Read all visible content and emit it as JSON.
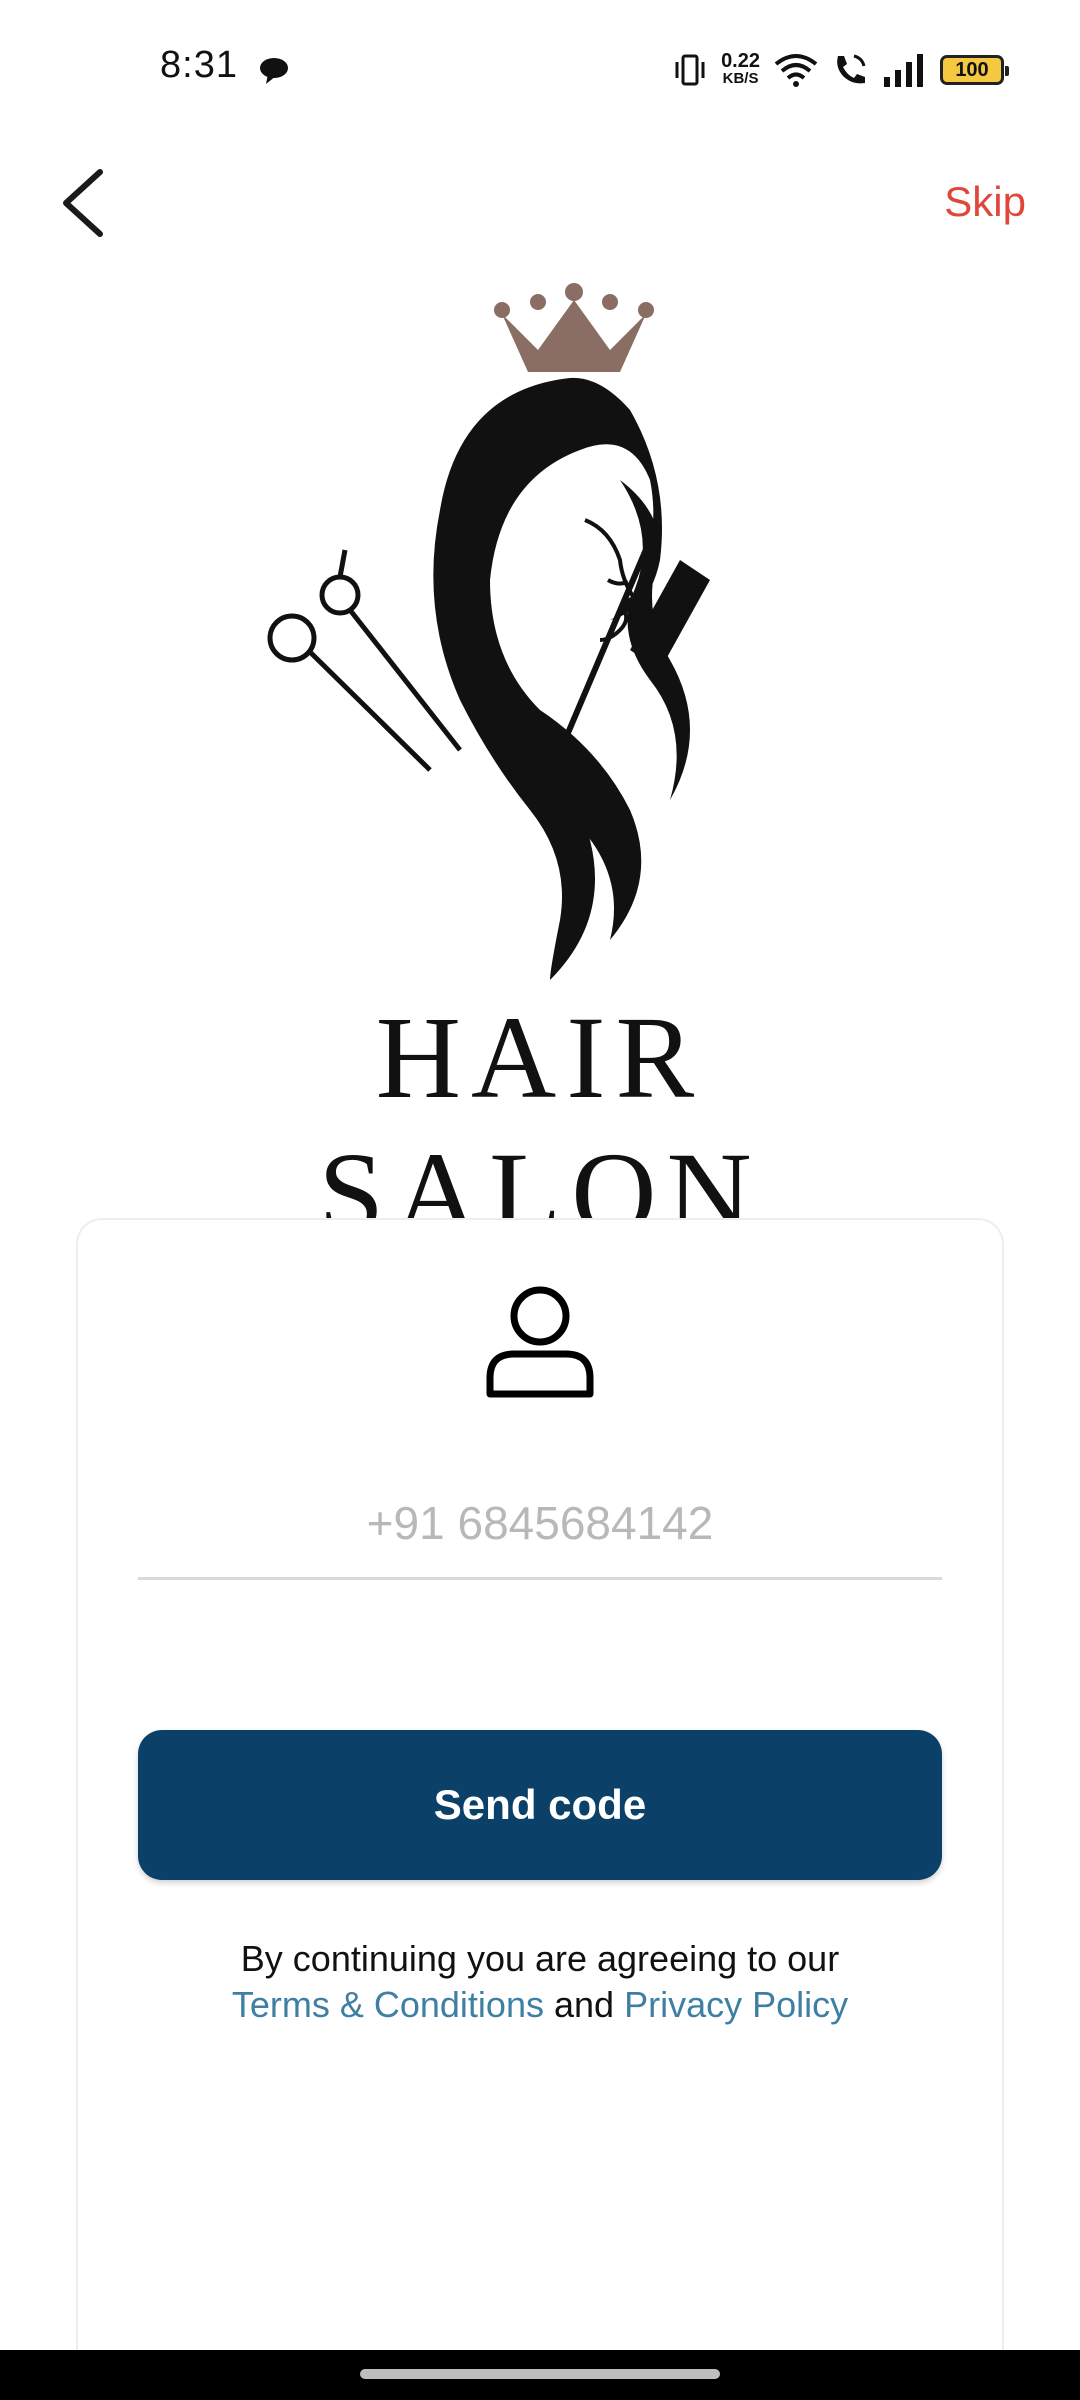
{
  "status_bar": {
    "time": "8:31",
    "net_speed_value": "0.22",
    "net_speed_unit": "KB/S",
    "battery_level": "100"
  },
  "top_bar": {
    "skip_label": "Skip"
  },
  "logo": {
    "wordmark": "HAIR SALON"
  },
  "login": {
    "phone_placeholder": "+91 6845684142",
    "send_code_label": "Send code",
    "terms_prefix": "By continuing you are agreeing to our",
    "terms_link": "Terms & Conditions",
    "terms_and": "and",
    "privacy_link": "Privacy Policy"
  },
  "colors": {
    "accent_skip": "#e0473a",
    "primary_button": "#0b4168",
    "link": "#3e7fa3"
  }
}
